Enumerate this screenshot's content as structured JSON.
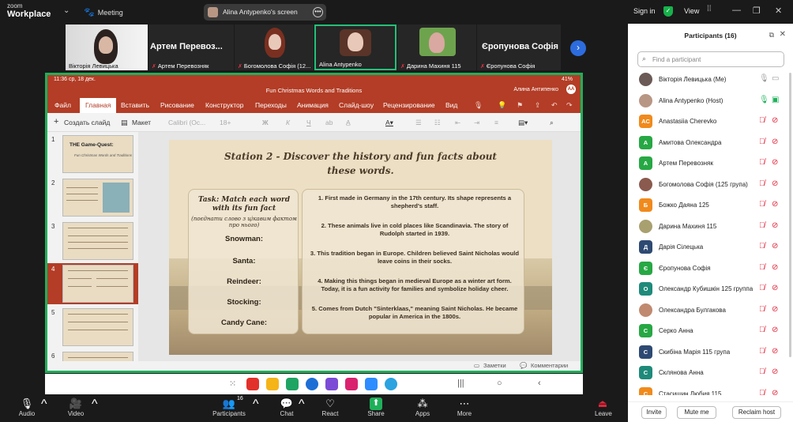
{
  "app": {
    "logo_top": "zoom",
    "logo_bottom": "Workplace",
    "meeting_label": "Meeting",
    "share_label": "Alina Antypenko's screen",
    "signin": "Sign in",
    "view": "View"
  },
  "thumbs": [
    {
      "name": "Вікторія Левицька"
    },
    {
      "name": "Артем Перевозняк",
      "big": "Артем  Перевоз..."
    },
    {
      "name": "Богомолова Софія (12..."
    },
    {
      "name": "Alina Antypenko"
    },
    {
      "name": "Дарина Махиня 115"
    },
    {
      "name": "Єропунова Софія",
      "big": "Єропунова Софія"
    }
  ],
  "ppt": {
    "status_time": "11:36  ср, 18 дек.",
    "battery": "41%",
    "title": "Fun Christmas Words and Traditions",
    "user": "Алина Антипенко",
    "user_initials": "AA",
    "tabs": [
      "Файл",
      "Главная",
      "Вставить",
      "Рисование",
      "Конструктор",
      "Переходы",
      "Анимация",
      "Слайд-шоу",
      "Рецензирование",
      "Вид"
    ],
    "tool_new_slide": "Создать слайд",
    "tool_layout": "Макет",
    "tool_font": "Calibri (Ос...",
    "tool_size": "18+",
    "thumb1_title": "THE Game-Quest:",
    "thumb1_sub": "Fun Christmas Words and Traditions",
    "slide_numbers": [
      "1",
      "2",
      "3",
      "4",
      "5",
      "6"
    ],
    "notes": "Заметки",
    "comments": "Комментарии"
  },
  "slide": {
    "title_line1": "Station 2 - Discover the history and fun facts about",
    "title_line2": "these words.",
    "task_head": "Task: Match each word with its fun fact",
    "task_sub": "(поєднати слово з цікавим фактом про нього)",
    "words": [
      "Snowman:",
      "Santa:",
      "Reindeer:",
      "Stocking:",
      "Candy Cane:"
    ],
    "facts": [
      "1. First made in Germany in the 17th century. Its shape represents a shepherd's staff.",
      "2. These animals live in cold places like Scandinavia. The story of Rudolph started in 1939.",
      "3. This tradition began in Europe. Children believed Saint Nicholas would leave coins in their socks.",
      "4. Making this things began in medieval Europe as a winter art form. Today, it is a fun activity for families and symbolize holiday cheer.",
      "5. Comes from Dutch \"Sinterklaas,\" meaning Saint Nicholas. He became popular in America in the 1800s."
    ]
  },
  "panel": {
    "title": "Participants (16)",
    "search_placeholder": "Find a participant",
    "participants": [
      {
        "name": "Вікторія Левицька (Me)",
        "initial": "",
        "color": "#6b5a55",
        "mic": "on"
      },
      {
        "name": "Alina Antypenko (Host)",
        "initial": "",
        "color": "#b89684",
        "mic": "host"
      },
      {
        "name": "Anastasiia Cherevko",
        "initial": "AC",
        "color": "#f08a1c",
        "mic": "off"
      },
      {
        "name": "Амитова Олександра",
        "initial": "A",
        "color": "#27a844",
        "mic": "off"
      },
      {
        "name": "Артем Перевозняк",
        "initial": "A",
        "color": "#27a844",
        "mic": "off"
      },
      {
        "name": "Богомолова Софія (125 група)",
        "initial": "",
        "color": "#8a5a4e",
        "mic": "off"
      },
      {
        "name": "Божко Даяна 125",
        "initial": "Б",
        "color": "#f08a1c",
        "mic": "off"
      },
      {
        "name": "Дарина Махиня 115",
        "initial": "",
        "color": "#a9a070",
        "mic": "off"
      },
      {
        "name": "Дарія Сілецька",
        "initial": "Д",
        "color": "#2e4a72",
        "mic": "off"
      },
      {
        "name": "Єропунова Софія",
        "initial": "Є",
        "color": "#27a844",
        "mic": "off"
      },
      {
        "name": "Олександр Кубишкін 125 группа",
        "initial": "О",
        "color": "#1f8a7a",
        "mic": "off"
      },
      {
        "name": "Олександра Булгакова",
        "initial": "",
        "color": "#c08a70",
        "mic": "off"
      },
      {
        "name": "Серко Анна",
        "initial": "С",
        "color": "#27a844",
        "mic": "off"
      },
      {
        "name": "Скибіна Марія 115 група",
        "initial": "С",
        "color": "#2e4a72",
        "mic": "off"
      },
      {
        "name": "Склянова Анна",
        "initial": "С",
        "color": "#1f8a7a",
        "mic": "off"
      },
      {
        "name": "Стасишин Любия 115",
        "initial": "С",
        "color": "#f08a1c",
        "mic": "off"
      }
    ],
    "invite": "Invite",
    "mute_me": "Mute me",
    "reclaim": "Reclaim host"
  },
  "toolbar": {
    "audio": "Audio",
    "video": "Video",
    "participants": "Participants",
    "participants_count": "16",
    "chat": "Chat",
    "react": "React",
    "share": "Share",
    "apps": "Apps",
    "more": "More",
    "leave": "Leave"
  },
  "colors": {
    "accent": "#1fb05a",
    "ppt_red": "#b33d26",
    "mic_off": "#e0263a"
  }
}
